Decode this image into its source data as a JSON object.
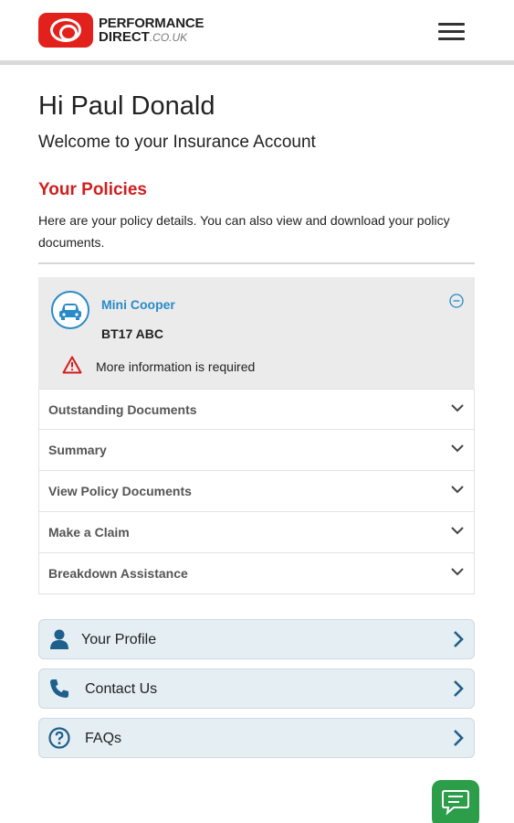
{
  "header": {
    "brand_line1": "PERFORMANCE",
    "brand_line2": "DIRECT",
    "brand_suffix": ".CO.UK",
    "logo_icon": "performance-direct-logo",
    "menu_icon": "hamburger-menu-icon",
    "brand_color": "#e3211c"
  },
  "greeting": "Hi Paul Donald",
  "welcome": "Welcome to your Insurance Account",
  "policies": {
    "title": "Your Policies",
    "description": "Here are your policy details. You can also view and download your policy documents.",
    "title_color": "#d11e1e"
  },
  "policy": {
    "car_name": "Mini Cooper",
    "registration": "BT17 ABC",
    "warning": "More information is required",
    "car_icon": "car-icon",
    "collapse_icon": "minus-circle-icon",
    "warning_icon": "warning-triangle-icon",
    "accent_color": "#2a8bc9"
  },
  "accordion": [
    {
      "label": "Outstanding Documents"
    },
    {
      "label": "Summary"
    },
    {
      "label": "View Policy Documents"
    },
    {
      "label": "Make a Claim"
    },
    {
      "label": "Breakdown Assistance"
    }
  ],
  "links": {
    "profile": {
      "label": "Your Profile",
      "icon": "user-icon"
    },
    "contact": {
      "label": "Contact Us",
      "icon": "phone-icon"
    },
    "faqs": {
      "label": "FAQs",
      "icon": "question-circle-icon"
    }
  },
  "chat": {
    "icon": "chat-bubble-icon",
    "color": "#2c9e4a"
  }
}
